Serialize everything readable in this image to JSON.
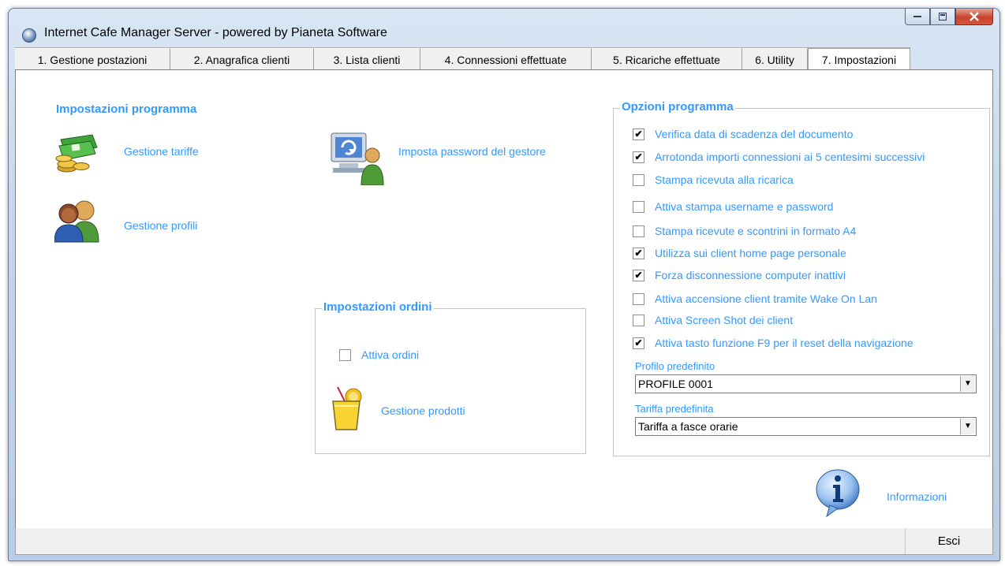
{
  "window": {
    "title": "Internet Cafe Manager Server - powered by Pianeta Software"
  },
  "tabs": [
    {
      "label": "1. Gestione postazioni"
    },
    {
      "label": "2. Anagrafica clienti"
    },
    {
      "label": "3. Lista clienti"
    },
    {
      "label": "4. Connessioni effettuate"
    },
    {
      "label": "5. Ricariche effettuate"
    },
    {
      "label": "6. Utility"
    },
    {
      "label": "7. Impostazioni",
      "active": true
    }
  ],
  "program_settings": {
    "title": "Impostazioni programma",
    "tariffs_link": "Gestione tariffe",
    "profiles_link": "Gestione profili",
    "password_link": "Imposta password del gestore"
  },
  "orders": {
    "title": "Impostazioni ordini",
    "enable_orders": {
      "label": "Attiva ordini",
      "checked": false
    },
    "products_link": "Gestione prodotti"
  },
  "options": {
    "title": "Opzioni programma",
    "items": [
      {
        "label": "Verifica data di scadenza del documento",
        "checked": true
      },
      {
        "label": "Arrotonda importi connessioni ai 5 centesimi successivi",
        "checked": true
      },
      {
        "label": "Stampa ricevuta alla ricarica",
        "checked": false
      },
      {
        "label": "Attiva stampa username e password",
        "checked": false
      },
      {
        "label": "Stampa ricevute e scontrini in formato A4",
        "checked": false
      },
      {
        "label": "Utilizza sui client home page personale",
        "checked": true
      },
      {
        "label": "Forza disconnessione computer inattivi",
        "checked": true
      },
      {
        "label": "Attiva accensione client tramite Wake On Lan",
        "checked": false
      },
      {
        "label": "Attiva Screen Shot dei client",
        "checked": false
      },
      {
        "label": "Attiva tasto funzione F9 per il reset della navigazione",
        "checked": true
      }
    ],
    "default_profile": {
      "label": "Profilo predefinito",
      "value": "PROFILE 0001"
    },
    "default_tariff": {
      "label": "Tariffa predefinita",
      "value": "Tariffa a fasce orarie"
    }
  },
  "info_link": "Informazioni",
  "exit_button": "Esci",
  "colors": {
    "accent": "#3399ff"
  }
}
